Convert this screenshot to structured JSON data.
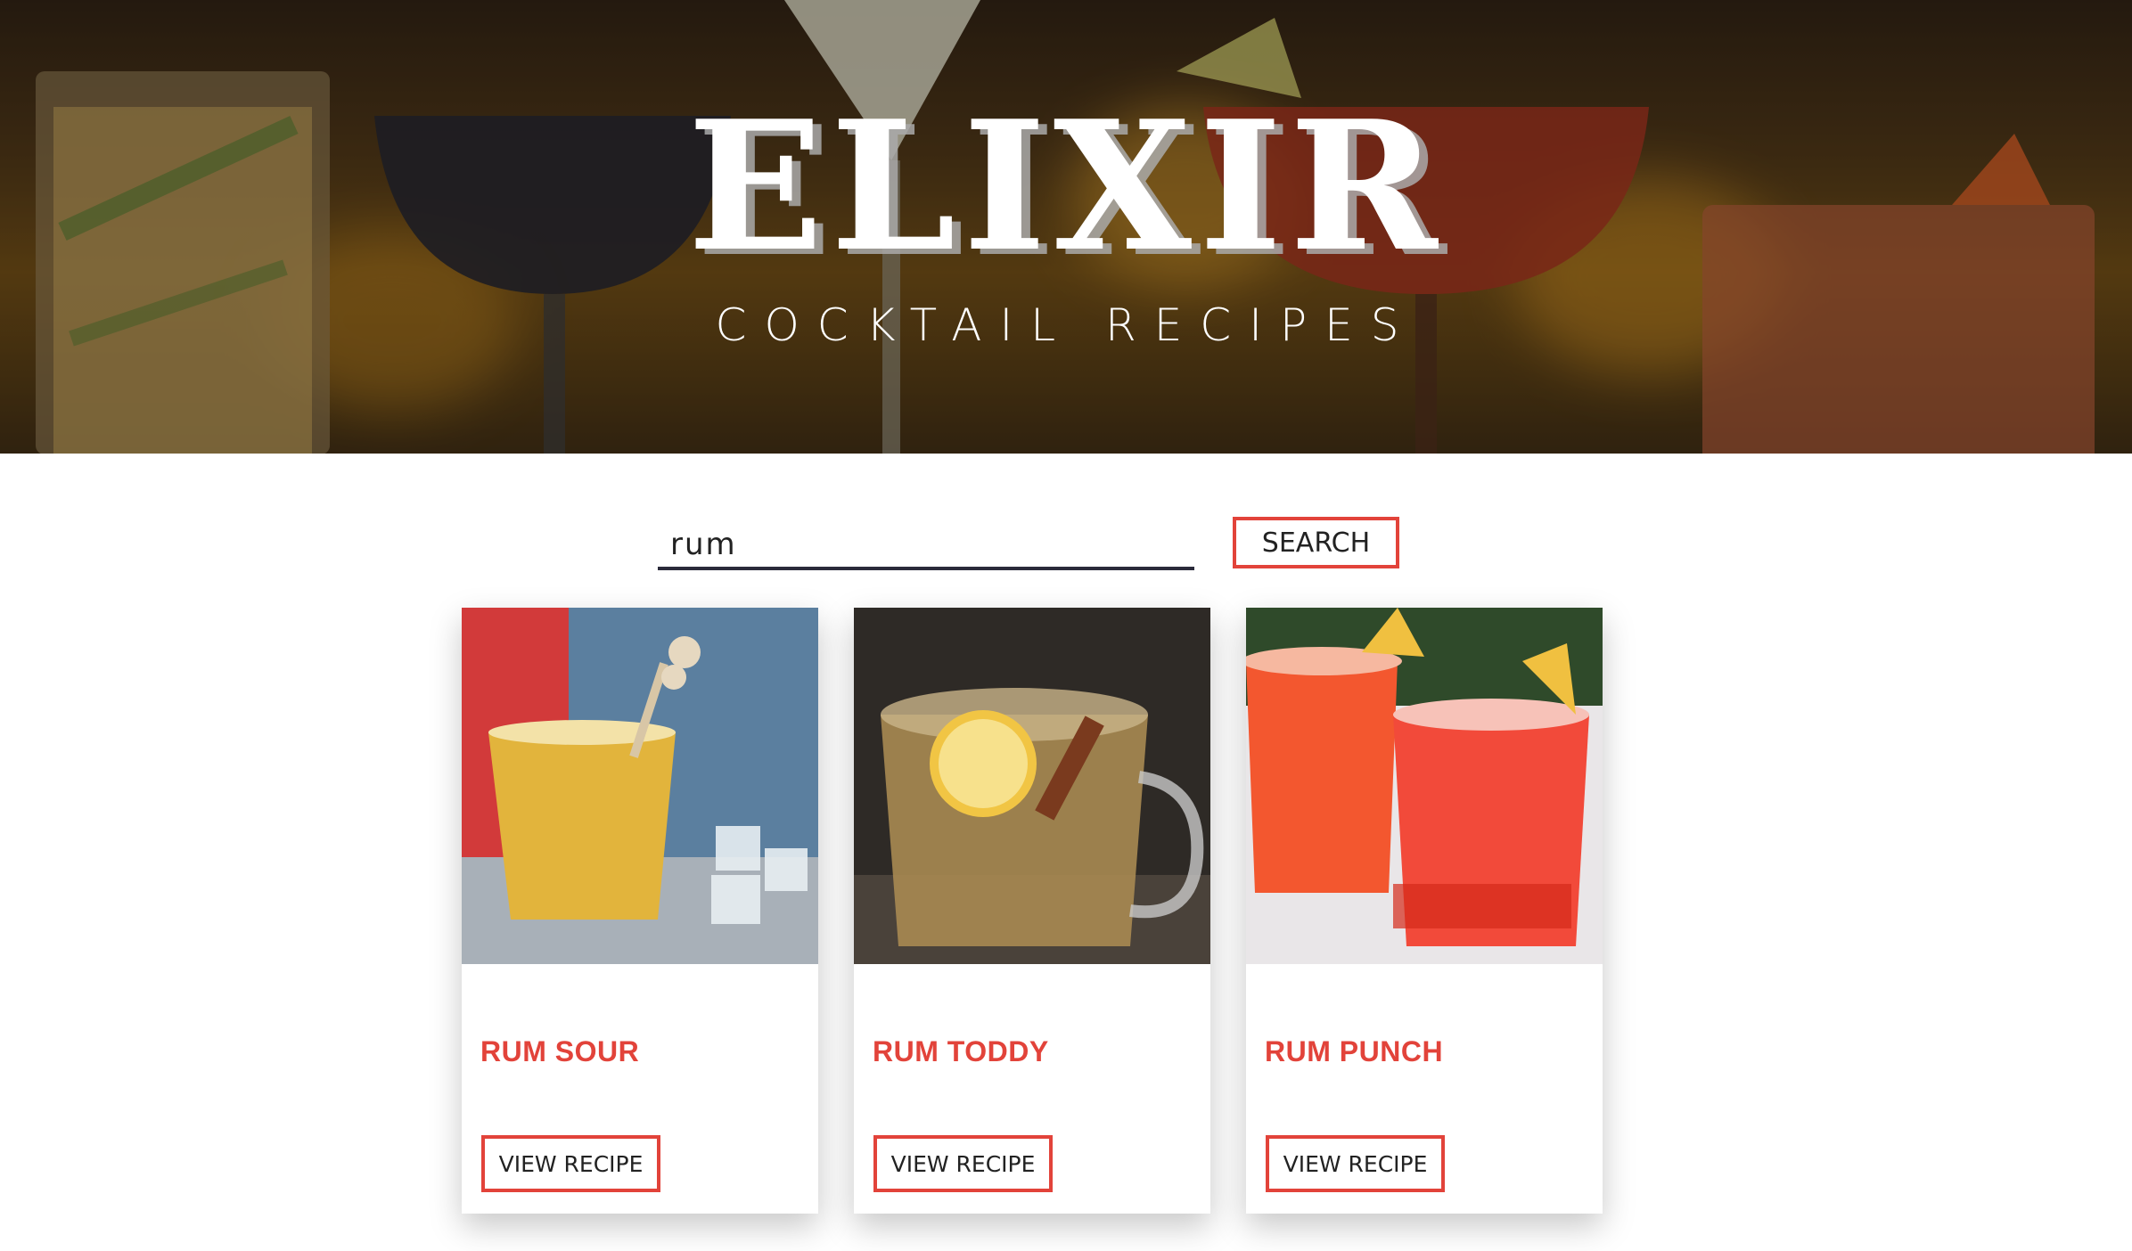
{
  "hero": {
    "title": "ELIXIR",
    "subtitle": "COCKTAIL RECIPES"
  },
  "search": {
    "value": "rum",
    "button_label": "SEARCH"
  },
  "results": [
    {
      "name": "RUM SOUR",
      "button_label": "VIEW RECIPE"
    },
    {
      "name": "RUM TODDY",
      "button_label": "VIEW RECIPE"
    },
    {
      "name": "RUM PUNCH",
      "button_label": "VIEW RECIPE"
    }
  ],
  "colors": {
    "accent": "#e2433a",
    "input_underline": "#2a2a3a"
  }
}
